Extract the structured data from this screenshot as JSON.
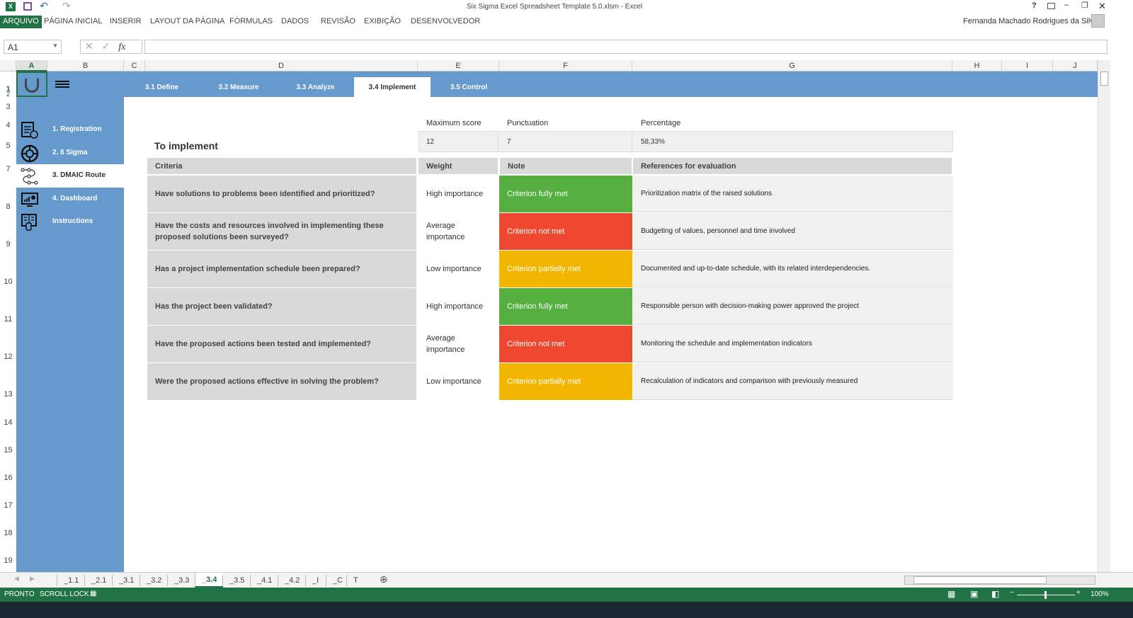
{
  "window": {
    "title": "Six Sigma Excel Spreadsheet Template 5.0.xlsm - Excel",
    "user": "Fernanda Machado Rodrigues da Silva"
  },
  "ribbon": {
    "file": "ARQUIVO",
    "tabs": [
      "PÁGINA INICIAL",
      "INSERIR",
      "LAYOUT DA PÁGINA",
      "FÓRMULAS",
      "DADOS",
      "REVISÃO",
      "EXIBIÇÃO",
      "DESENVOLVEDOR"
    ]
  },
  "formula": {
    "name_box": "A1",
    "fx": "fx",
    "value": ""
  },
  "columns": [
    "A",
    "B",
    "C",
    "D",
    "E",
    "F",
    "G",
    "H",
    "I",
    "J"
  ],
  "rows": [
    "1",
    "2",
    "3",
    "4",
    "5",
    "7",
    "8",
    "9",
    "10",
    "11",
    "12",
    "13",
    "14",
    "15",
    "16",
    "17",
    "18",
    "19"
  ],
  "phase_tabs": [
    {
      "label": "3.1 Define"
    },
    {
      "label": "3.2 Measure"
    },
    {
      "label": "3.3 Analyze"
    },
    {
      "label": "3.4 Implement",
      "active": true
    },
    {
      "label": "3.5 Control"
    }
  ],
  "sidebar": [
    {
      "label": "1. Registration",
      "icon": "document-edit-icon"
    },
    {
      "label": "2. 6 Sigma",
      "icon": "sigma-wheel-icon"
    },
    {
      "label": "3. DMAIC Route",
      "icon": "route-icon",
      "active": true
    },
    {
      "label": "4. Dashboard",
      "icon": "dashboard-icon"
    },
    {
      "label": "Instructions",
      "icon": "instructions-icon"
    }
  ],
  "section_title": "To implement",
  "score": {
    "headers": [
      "Maximum score",
      "Punctuation",
      "Percentage"
    ],
    "values": [
      "12",
      "7",
      "58,33%"
    ]
  },
  "table": {
    "headers": [
      "Criteria",
      "Weight",
      "Note",
      "References for evaluation"
    ],
    "rows": [
      {
        "criteria": "Have solutions to problems been identified and prioritized?",
        "weight": "High importance",
        "note": "Criterion fully met",
        "ref": "Prioritization matrix of the raised solutions"
      },
      {
        "criteria": "Have the costs and resources involved in implementing these proposed solutions been surveyed?",
        "weight": "Average importance",
        "note": "Criterion not met",
        "ref": "Budgeting of values, personnel and time involved"
      },
      {
        "criteria": "Has a project implementation schedule been prepared?",
        "weight": "Low importance",
        "note": "Criterion partially met",
        "ref": "Documented and up-to-date schedule, with its related interdependencies."
      },
      {
        "criteria": "Has the project been validated?",
        "weight": "High importance",
        "note": "Criterion fully met",
        "ref": "Responsible person with decision-making power approved the project"
      },
      {
        "criteria": "Have the proposed actions been tested and implemented?",
        "weight": "Average importance",
        "note": "Criterion not met",
        "ref": "Monitoring the schedule and implementation indicators"
      },
      {
        "criteria": "Were the proposed actions effective in solving the problem?",
        "weight": "Low importance",
        "note": "Criterion partially met",
        "ref": "Recalculation of indicators and comparison with previously measured"
      }
    ]
  },
  "note_colors": {
    "Criterion fully met": "#55b040",
    "Criterion not met": "#ef4830",
    "Criterion partially met": "#f2b600"
  },
  "sheet_tabs": [
    "_1.1",
    "_2.1",
    "_3.1",
    "_3.2",
    "_3.3",
    "_3.4",
    "_3.5",
    "_4.1",
    "_4.2",
    "_I",
    "_C",
    "T"
  ],
  "active_sheet": "_3.4",
  "status": {
    "ready": "PRONTO",
    "scroll_lock": "SCROLL LOCK",
    "zoom": "100%"
  }
}
